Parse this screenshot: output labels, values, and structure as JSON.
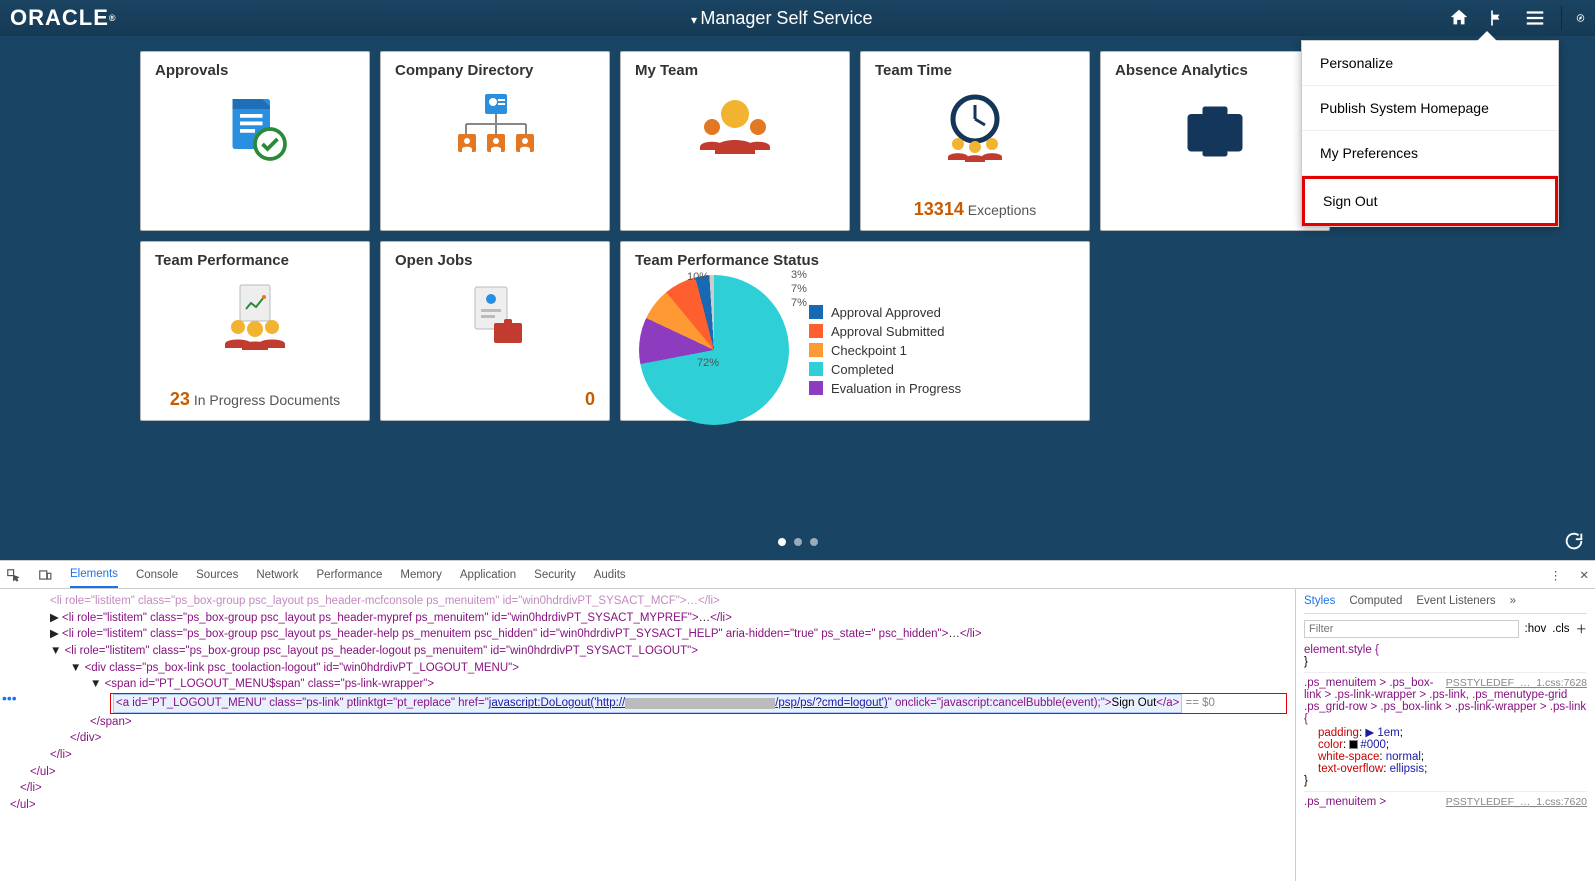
{
  "header": {
    "logo": "ORACLE",
    "title": "Manager Self Service"
  },
  "dropdown": {
    "items": [
      "Personalize",
      "Publish System Homepage",
      "My Preferences",
      "Sign Out"
    ],
    "highlight_index": 3
  },
  "tiles": {
    "approvals": {
      "title": "Approvals"
    },
    "directory": {
      "title": "Company Directory"
    },
    "myteam": {
      "title": "My Team"
    },
    "teamtime": {
      "title": "Team Time",
      "stat_num": "13314",
      "stat_label": "Exceptions"
    },
    "absence": {
      "title": "Absence Analytics"
    },
    "teamperf": {
      "title": "Team Performance",
      "stat_num": "23",
      "stat_label": "In Progress Documents"
    },
    "openjobs": {
      "title": "Open Jobs",
      "stat_num": "0"
    },
    "perfstatus": {
      "title": "Team Performance Status"
    }
  },
  "chart_data": {
    "type": "pie",
    "title": "Team Performance Status",
    "series": [
      {
        "name": "Approval Approved",
        "value": 3,
        "color": "#1669b2"
      },
      {
        "name": "Approval Submitted",
        "value": 7,
        "color": "#ff5f2e"
      },
      {
        "name": "Checkpoint 1",
        "value": 7,
        "color": "#ff9933"
      },
      {
        "name": "Completed",
        "value": 72,
        "color": "#2ecfd6"
      },
      {
        "name": "Evaluation in Progress",
        "value": 10,
        "color": "#8d3cc0"
      }
    ],
    "labels": [
      "3%",
      "7%",
      "7%",
      "72%",
      "10%"
    ]
  },
  "devtools": {
    "tabs": [
      "Elements",
      "Console",
      "Sources",
      "Network",
      "Performance",
      "Memory",
      "Application",
      "Security",
      "Audits"
    ],
    "active_tab": 0,
    "styles_tabs": [
      "Styles",
      "Computed",
      "Event Listeners"
    ],
    "styles_active": 0,
    "filter_placeholder": "Filter",
    "hov": ":hov",
    "cls": ".cls",
    "dom_lines": {
      "l0": "<li role=\"listitem\" class=\"ps_box-group psc_layout ps_header-mcfconsole ps_menuitem\" id=\"win0hdrdivPT_SYSACT_MCF\">…</li>",
      "l1_open": "<li role=\"listitem\" class=\"ps_box-group psc_layout ps_header-mypref ps_menuitem\" id=\"win0hdrdivPT_SYSACT_MYPREF\">",
      "l1_mid": "…",
      "l1_close": "</li>",
      "l2_open": "<li role=\"listitem\" class=\"ps_box-group psc_layout ps_header-help ps_menuitem psc_hidden\" id=\"win0hdrdivPT_SYSACT_HELP\" aria-hidden=\"true\" ps_state=\" psc_hidden\">",
      "l2_mid": "…",
      "l2_close": "</li>",
      "l3": "<li role=\"listitem\" class=\"ps_box-group psc_layout ps_header-logout ps_menuitem\" id=\"win0hdrdivPT_SYSACT_LOGOUT\">",
      "l4": "<div class=\"ps_box-link psc_toolaction-logout\" id=\"win0hdrdivPT_LOGOUT_MENU\">",
      "l5": "<span id=\"PT_LOGOUT_MENU$span\" class=\"ps-link-wrapper\">",
      "l6a": "<a id=\"PT_LOGOUT_MENU\" class=\"ps-link\" ptlinktgt=\"pt_replace\" href=\"",
      "l6href1": "javascript:DoLogout('http://",
      "l6href2": "/psp/ps/?cmd=logout')",
      "l6b": "\" onclick=\"javascript:cancelBubble(event);\">",
      "l6text": "Sign Out",
      "l6close": "</a>",
      "eq0": " == $0",
      "l7": "</span>",
      "l8": "</div>",
      "l9": "</li>",
      "l10": "</ul>",
      "l11": "</li>",
      "l12": "</ul>"
    },
    "styles": {
      "rule0_sel": "element.style {",
      "rule0_close": "}",
      "rule1_sel": ".ps_menuitem > .ps_box-link > .ps-link-wrapper > .ps-link, .ps_menutype-grid .ps_grid-row > .ps_box-link > .ps-link-wrapper > .ps-link {",
      "rule1_src": "PSSTYLEDEF_…_1.css:7628",
      "rule1_p1": "padding",
      "rule1_v1": "▶ 1em",
      "rule1_p2": "color",
      "rule1_v2": "#000",
      "rule1_p3": "white-space",
      "rule1_v3": "normal",
      "rule1_p4": "text-overflow",
      "rule1_v4": "ellipsis",
      "rule1_close": "}",
      "rule2_sel": ".ps_menuitem >",
      "rule2_src": "PSSTYLEDEF_…_1.css:7620"
    }
  }
}
